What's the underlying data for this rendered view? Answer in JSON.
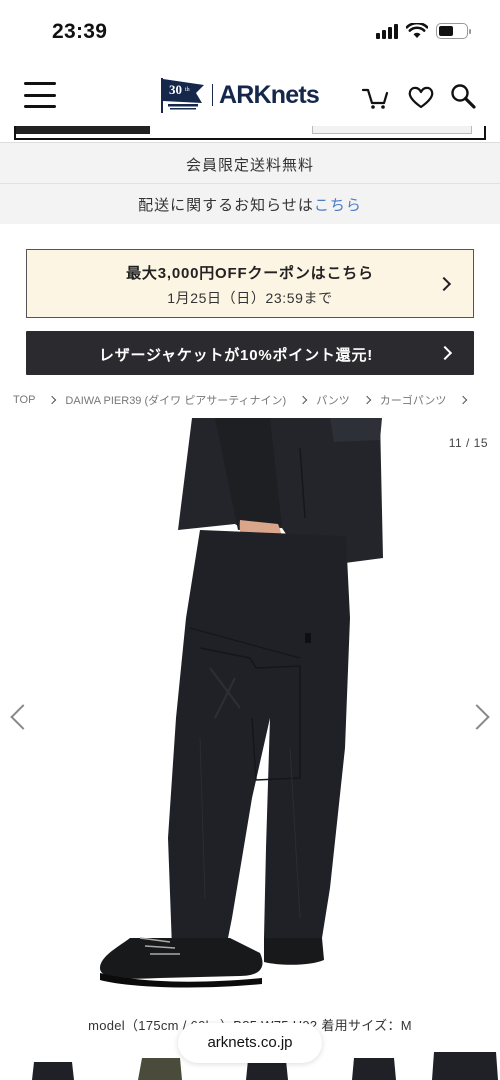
{
  "status_bar": {
    "time": "23:39"
  },
  "header": {
    "logo_text": "ARKnets",
    "logo_icon": "arknets-30th-flag-logo",
    "menu_icon": "hamburger-menu-icon",
    "cart_icon": "cart-icon",
    "heart_icon": "heart-icon",
    "search_icon": "search-icon"
  },
  "notices": {
    "members_shipping": "会員限定送料無料",
    "shipping_prefix": "配送に関するお知らせは",
    "shipping_link": "こちら"
  },
  "coupon": {
    "title": "最大3,000円OFFクーポンはこちら",
    "subtitle": "1月25日（日）23:59まで"
  },
  "promo": {
    "label": "レザージャケットが10%ポイント還元!"
  },
  "breadcrumb": {
    "items": [
      "TOP",
      "DAIWA PIER39 (ダイワ ピアサーティナイン)",
      "パンツ",
      "カーゴパンツ"
    ]
  },
  "gallery": {
    "counter": "11 / 15",
    "model_info": "model（175cm / 60kg）B85 W75 H92 着用サイズ：M"
  },
  "browser": {
    "url": "arknets.co.jp"
  },
  "colors": {
    "brand_navy": "#15284b",
    "promo_bg": "#2b2b2f",
    "coupon_bg": "#fdf5e4",
    "link_blue": "#4a7bc4"
  }
}
